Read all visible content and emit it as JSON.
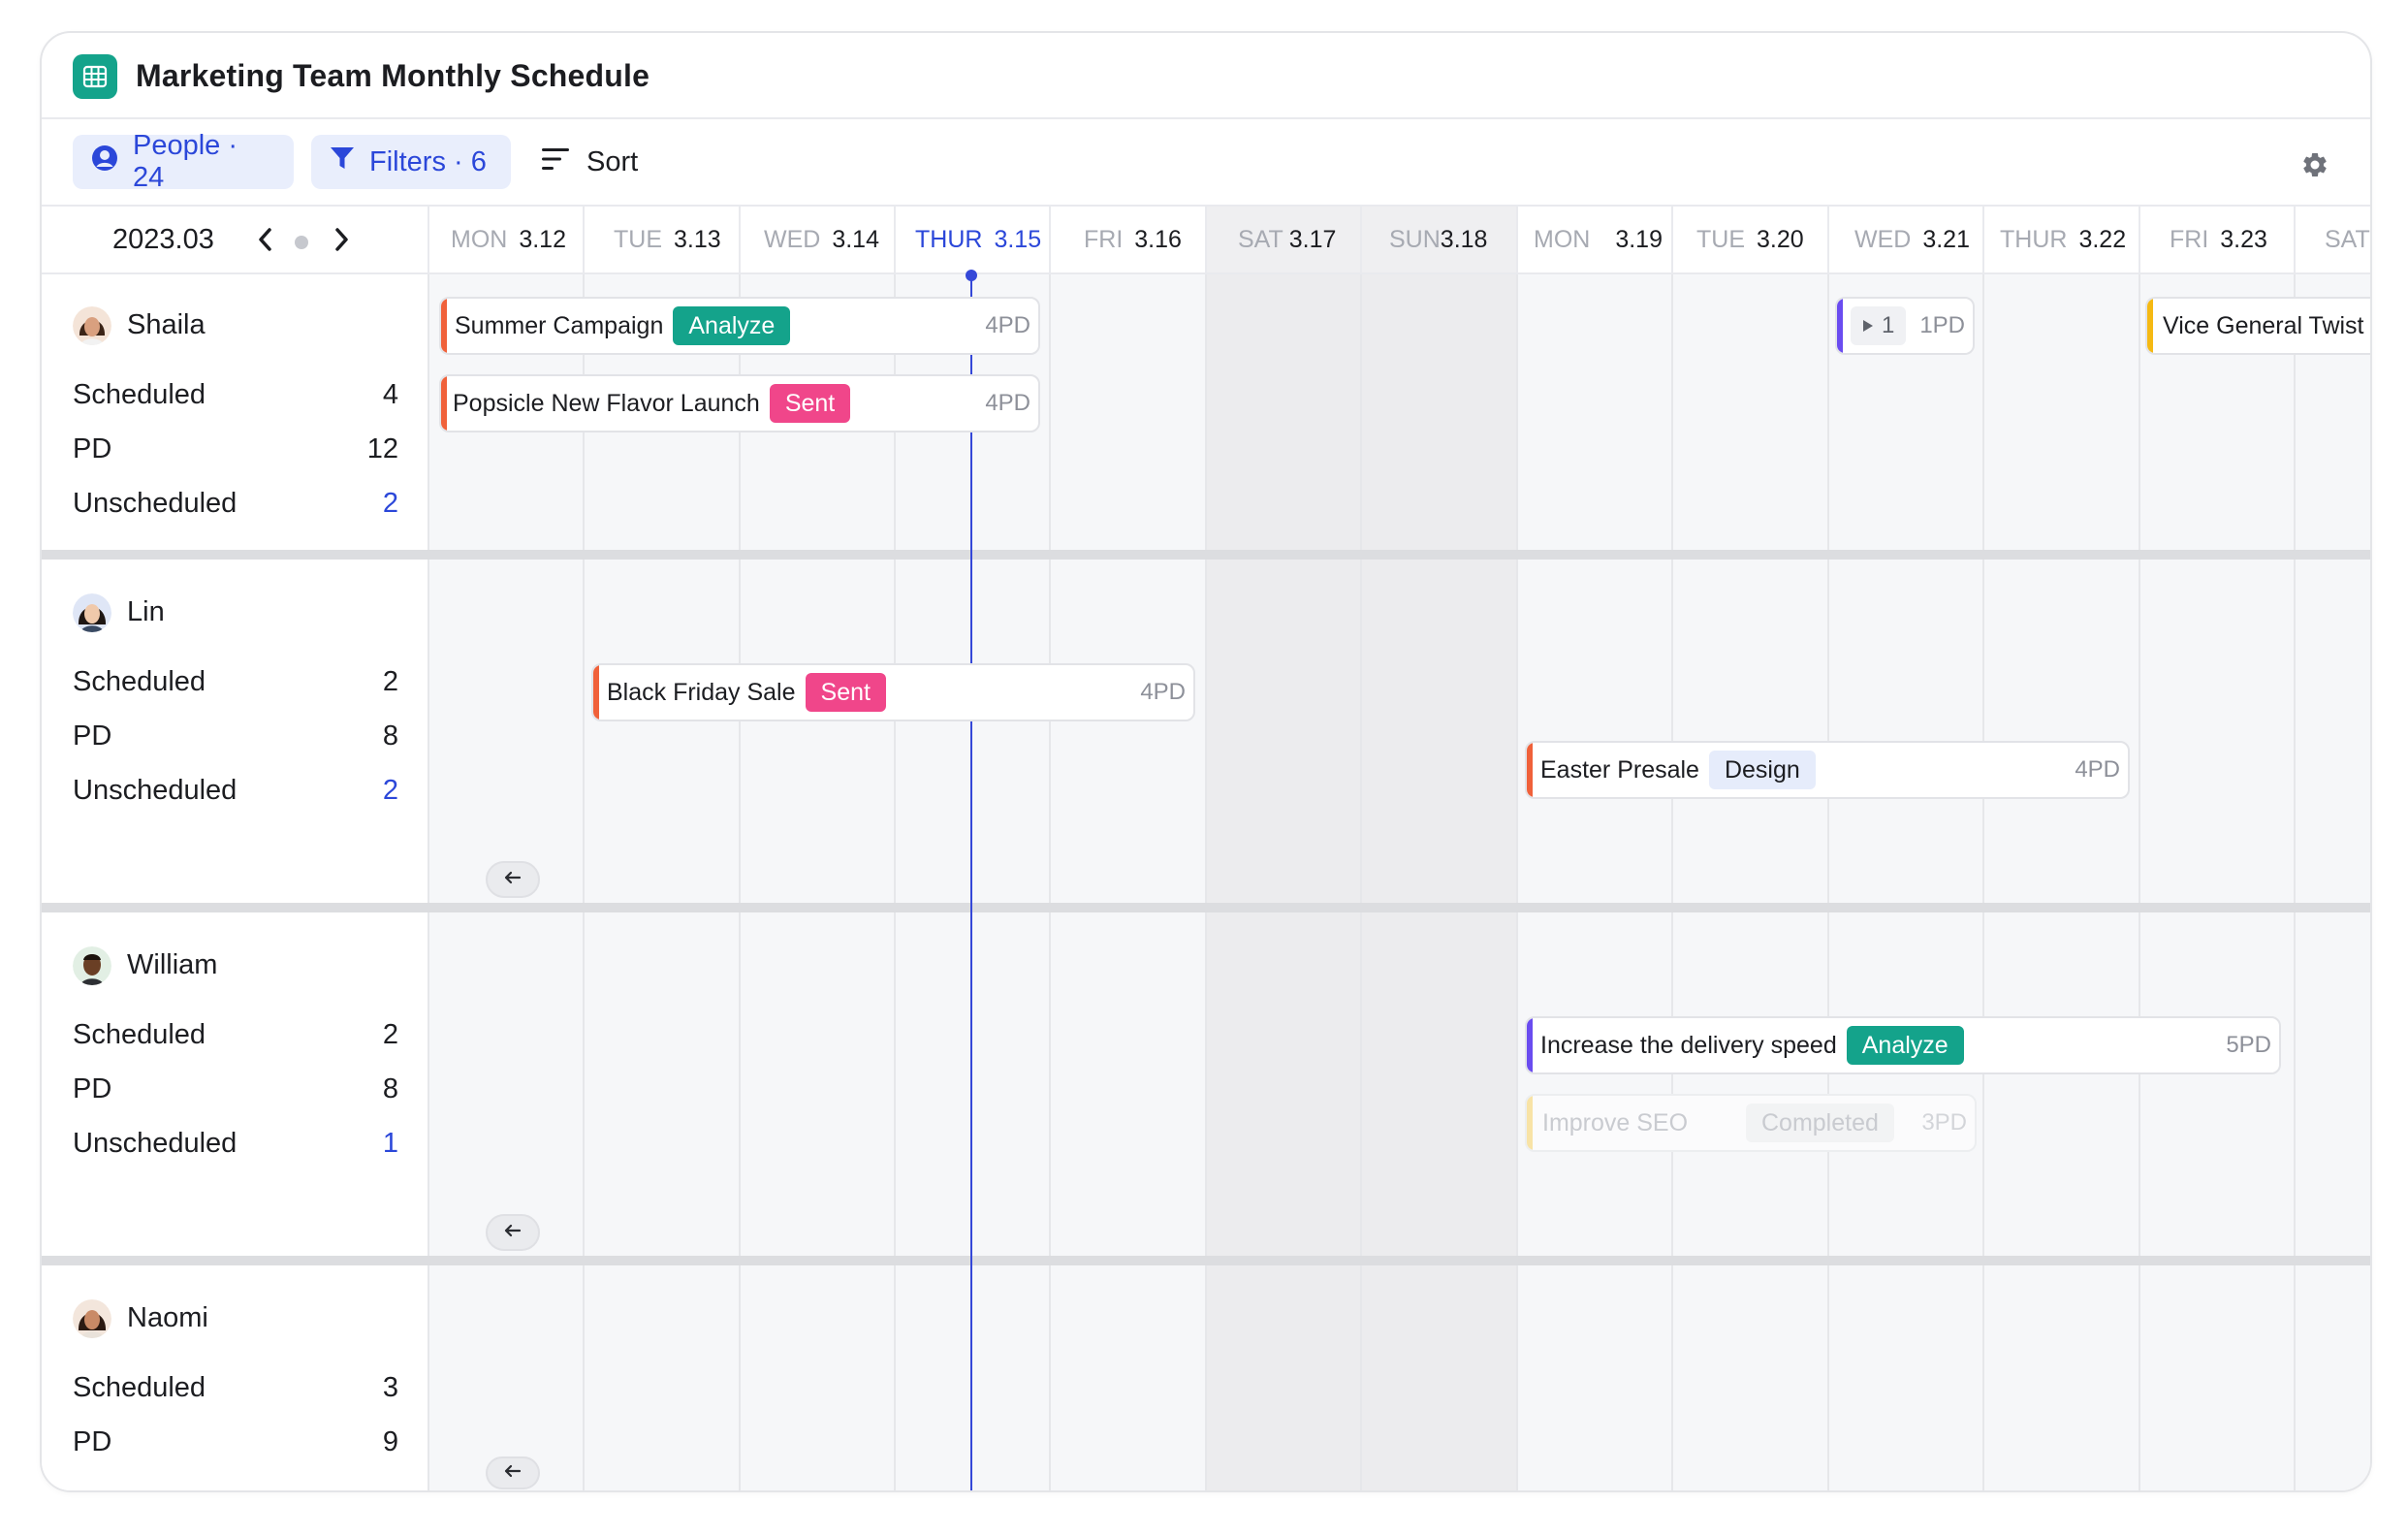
{
  "app": {
    "title": "Marketing Team Monthly Schedule",
    "icon": "spreadsheet-icon",
    "accent": "#14a38b"
  },
  "toolbar": {
    "people_label": "People · 24",
    "filters_label": "Filters · 6",
    "sort_label": "Sort",
    "settings_icon": "gear-icon"
  },
  "calendar": {
    "month": "2023.03",
    "days": [
      {
        "dow": "MON",
        "date": "3.12",
        "today": false,
        "weekend": false
      },
      {
        "dow": "TUE",
        "date": "3.13",
        "today": false,
        "weekend": false
      },
      {
        "dow": "WED",
        "date": "3.14",
        "today": false,
        "weekend": false
      },
      {
        "dow": "THUR",
        "date": "3.15",
        "today": true,
        "weekend": false
      },
      {
        "dow": "FRI",
        "date": "3.16",
        "today": false,
        "weekend": false
      },
      {
        "dow": "SAT",
        "date": "3.17",
        "today": false,
        "weekend": true
      },
      {
        "dow": "SUN",
        "date": "3.18",
        "today": false,
        "weekend": true
      },
      {
        "dow": "MON",
        "date": "3.19",
        "today": false,
        "weekend": false
      },
      {
        "dow": "TUE",
        "date": "3.20",
        "today": false,
        "weekend": false
      },
      {
        "dow": "WED",
        "date": "3.21",
        "today": false,
        "weekend": false
      },
      {
        "dow": "THUR",
        "date": "3.22",
        "today": false,
        "weekend": false
      },
      {
        "dow": "FRI",
        "date": "3.23",
        "today": false,
        "weekend": false
      },
      {
        "dow": "SAT",
        "date": "",
        "today": false,
        "weekend": false
      }
    ]
  },
  "people": [
    {
      "name": "Shaila",
      "stats": [
        {
          "label": "Scheduled",
          "value": "4",
          "highlight": false
        },
        {
          "label": "PD",
          "value": "12",
          "highlight": false
        },
        {
          "label": "Unscheduled",
          "value": "2",
          "highlight": true
        }
      ]
    },
    {
      "name": "Lin",
      "stats": [
        {
          "label": "Scheduled",
          "value": "2",
          "highlight": false
        },
        {
          "label": "PD",
          "value": "8",
          "highlight": false
        },
        {
          "label": "Unscheduled",
          "value": "2",
          "highlight": true
        }
      ]
    },
    {
      "name": "William",
      "stats": [
        {
          "label": "Scheduled",
          "value": "2",
          "highlight": false
        },
        {
          "label": "PD",
          "value": "8",
          "highlight": false
        },
        {
          "label": "Unscheduled",
          "value": "1",
          "highlight": true
        }
      ]
    },
    {
      "name": "Naomi",
      "stats": [
        {
          "label": "Scheduled",
          "value": "3",
          "highlight": false
        },
        {
          "label": "PD",
          "value": "9",
          "highlight": false
        }
      ]
    }
  ],
  "tasks": {
    "summer": {
      "name": "Summer Campaign",
      "status": "Analyze",
      "pd": "4PD",
      "color": "#f0613a"
    },
    "popsicle": {
      "name": "Popsicle New Flavor Launch",
      "status": "Sent",
      "pd": "4PD",
      "color": "#f0613a"
    },
    "collapsed": {
      "count": "1",
      "pd": "1PD",
      "color": "#6a4cf0"
    },
    "vice": {
      "name": "Vice General Twist",
      "color": "#f5b913"
    },
    "black_friday": {
      "name": "Black Friday Sale",
      "status": "Sent",
      "pd": "4PD",
      "color": "#f0613a"
    },
    "easter": {
      "name": "Easter Presale",
      "status": "Design",
      "pd": "4PD",
      "color": "#f0613a"
    },
    "delivery": {
      "name": "Increase the delivery speed",
      "status": "Analyze",
      "pd": "5PD",
      "color": "#6a4cf0"
    },
    "seo": {
      "name": "Improve SEO",
      "status": "Completed",
      "pd": "3PD",
      "color": "#f8e3a6"
    }
  },
  "colors": {
    "today": "#2b47d9",
    "analyze": "#14a38b",
    "sent": "#f0468a",
    "unscheduled_value": "#2b47d9"
  }
}
